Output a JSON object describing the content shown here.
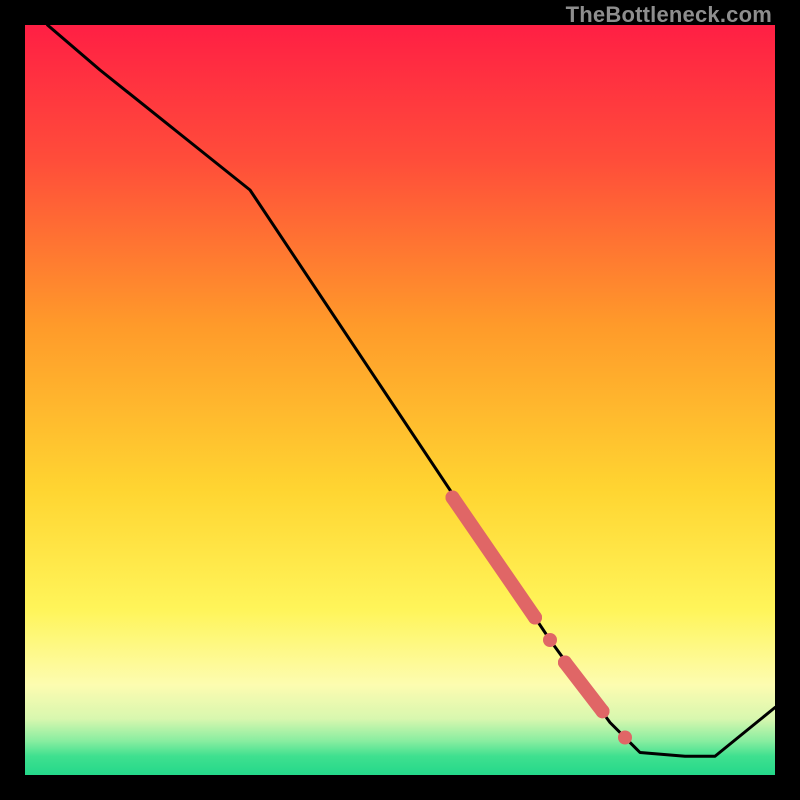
{
  "watermark": "TheBottleneck.com",
  "chart_data": {
    "type": "line",
    "title": "",
    "xlabel": "",
    "ylabel": "",
    "xlim": [
      0,
      100
    ],
    "ylim": [
      0,
      100
    ],
    "grid": false,
    "series": [
      {
        "name": "curve",
        "color": "#000000",
        "x": [
          3,
          10,
          20,
          30,
          40,
          50,
          60,
          70,
          78,
          82,
          88,
          92,
          100
        ],
        "y": [
          100,
          94,
          86,
          78,
          63,
          48,
          33,
          18,
          7,
          3,
          2.5,
          2.5,
          9
        ]
      },
      {
        "name": "highlight-band-1",
        "color": "#e06666",
        "x": [
          57,
          68
        ],
        "y": [
          37,
          21
        ]
      },
      {
        "name": "highlight-dot-1",
        "color": "#e06666",
        "x": [
          70
        ],
        "y": [
          18
        ]
      },
      {
        "name": "highlight-band-2",
        "color": "#e06666",
        "x": [
          72,
          77
        ],
        "y": [
          15,
          8.5
        ]
      },
      {
        "name": "highlight-dot-2",
        "color": "#e06666",
        "x": [
          80
        ],
        "y": [
          5
        ]
      }
    ],
    "background_gradient": {
      "description": "vertical red→orange→yellow→pale-yellow with thin green band at bottom",
      "stops": [
        {
          "offset": 0.0,
          "color": "#ff1f44"
        },
        {
          "offset": 0.18,
          "color": "#ff4d3a"
        },
        {
          "offset": 0.4,
          "color": "#ff9a2a"
        },
        {
          "offset": 0.62,
          "color": "#ffd531"
        },
        {
          "offset": 0.78,
          "color": "#fff55a"
        },
        {
          "offset": 0.88,
          "color": "#fdfcb0"
        },
        {
          "offset": 0.925,
          "color": "#d8f7af"
        },
        {
          "offset": 0.955,
          "color": "#87eda0"
        },
        {
          "offset": 0.975,
          "color": "#3fe08f"
        },
        {
          "offset": 1.0,
          "color": "#24d88a"
        }
      ]
    }
  }
}
